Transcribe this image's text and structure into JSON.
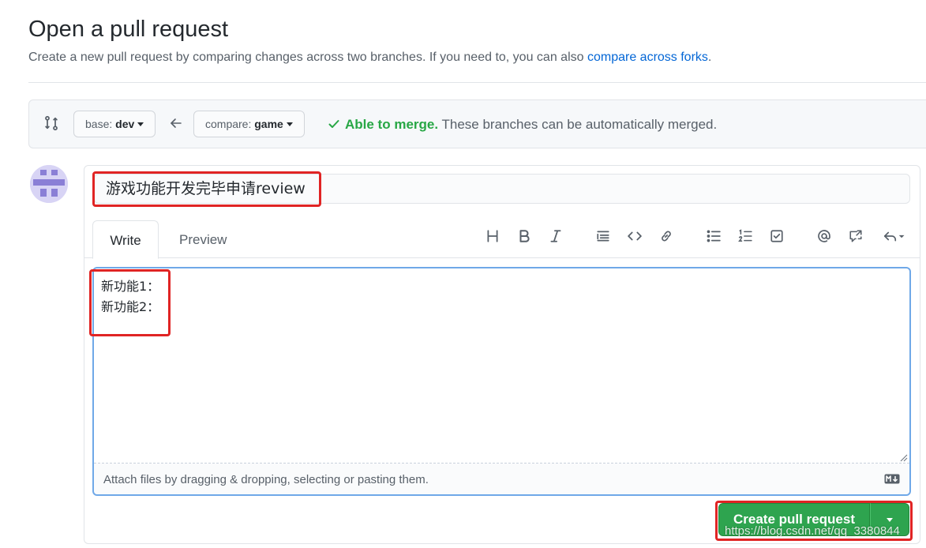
{
  "page": {
    "title": "Open a pull request",
    "subtitle_prefix": "Create a new pull request by comparing changes across two branches. If you need to, you can also ",
    "subtitle_link": "compare across forks",
    "subtitle_suffix": "."
  },
  "range": {
    "base_label": "base:",
    "base_value": "dev",
    "compare_label": "compare:",
    "compare_value": "game",
    "merge_ok": "Able to merge.",
    "merge_text": " These branches can be automatically merged."
  },
  "form": {
    "title_value": "游戏功能开发完毕申请review",
    "tabs": [
      "Write",
      "Preview"
    ],
    "toolbar_icons": [
      "heading-icon",
      "bold-icon",
      "italic-icon",
      "quote-icon",
      "code-icon",
      "link-icon",
      "bulleted-list-icon",
      "numbered-list-icon",
      "task-list-icon",
      "mention-icon",
      "reference-icon",
      "reply-icon"
    ],
    "body_lines": [
      "新功能1：",
      "新功能2："
    ],
    "attach_hint": "Attach files by dragging & dropping, selecting or pasting them.",
    "submit_label": "Create pull request"
  },
  "watermark": "https://blog.csdn.net/qq_3380844",
  "colors": {
    "accent": "#2ea44f",
    "link": "#0366d6",
    "success_text": "#28a745",
    "annotation_red": "#e02424"
  }
}
